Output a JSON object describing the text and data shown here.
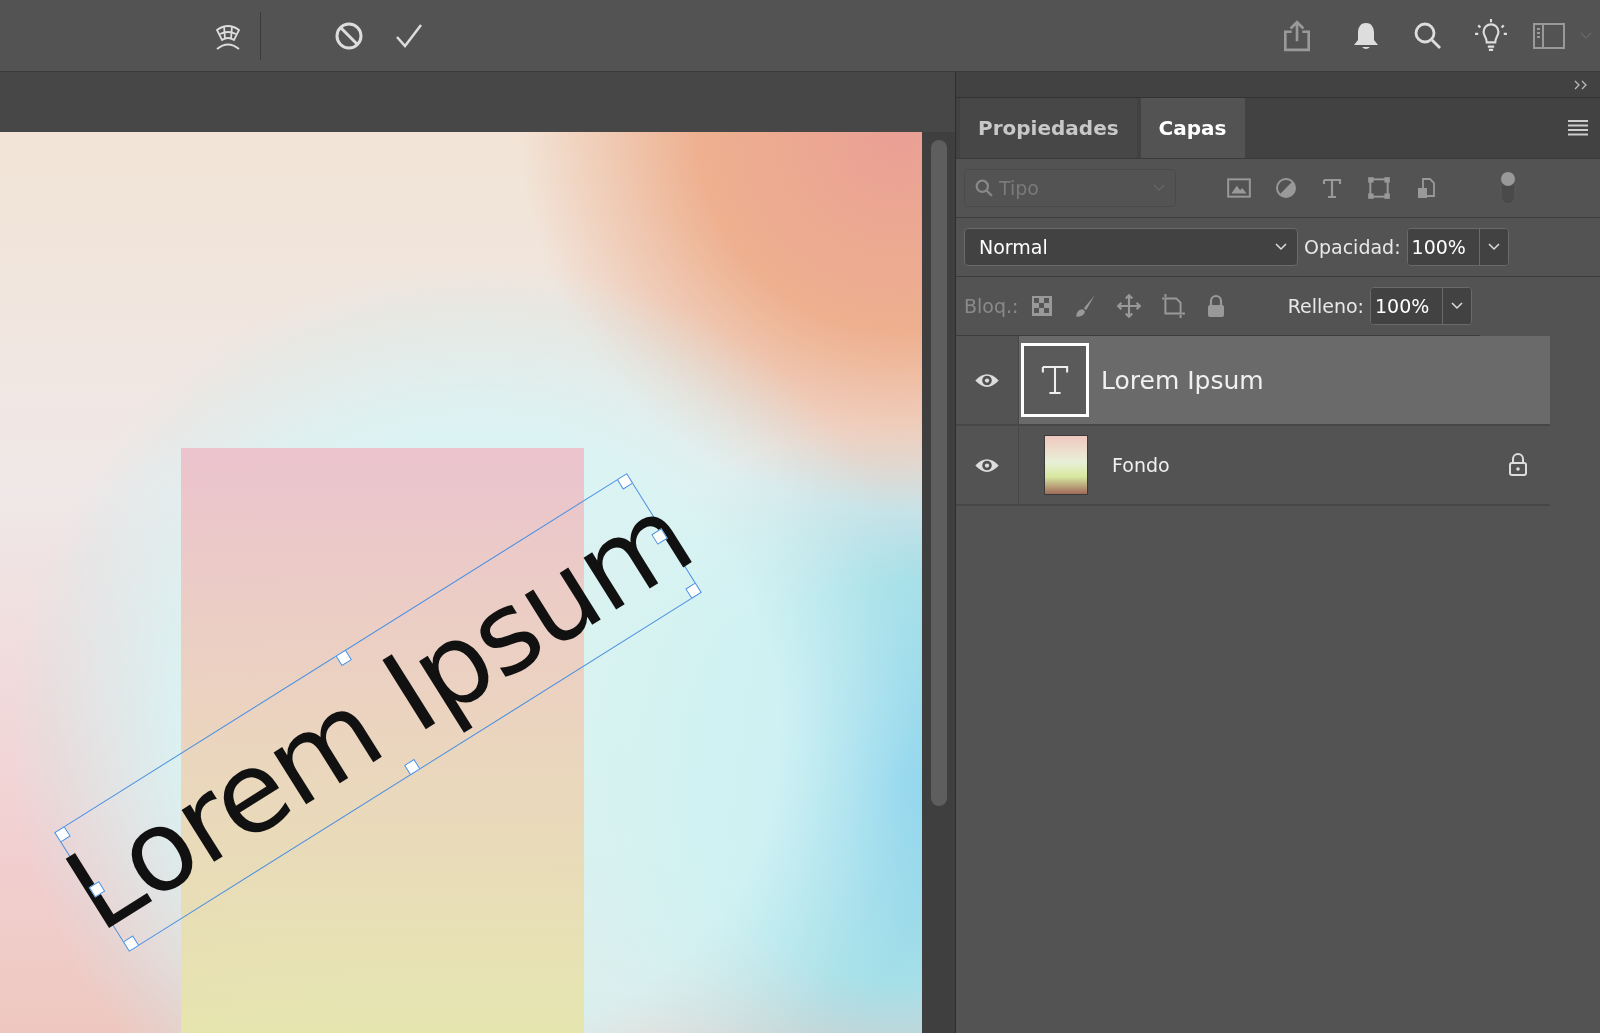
{
  "canvas": {
    "text": "Lorem Ipsum"
  },
  "panel": {
    "tabs": [
      {
        "label": "Propiedades",
        "selected": false
      },
      {
        "label": "Capas",
        "selected": true
      }
    ],
    "filter": {
      "placeholder": "Tipo"
    },
    "blend_mode": "Normal",
    "opacity": {
      "label": "Opacidad:",
      "value": "100%"
    },
    "lock": {
      "label": "Bloq.:"
    },
    "fill": {
      "label": "Relleno:",
      "value": "100%"
    },
    "layers": [
      {
        "name": "Lorem Ipsum",
        "kind": "text",
        "visible": true,
        "selected": true,
        "locked": false
      },
      {
        "name": "Fondo",
        "kind": "image",
        "visible": true,
        "selected": false,
        "locked": true
      }
    ]
  }
}
